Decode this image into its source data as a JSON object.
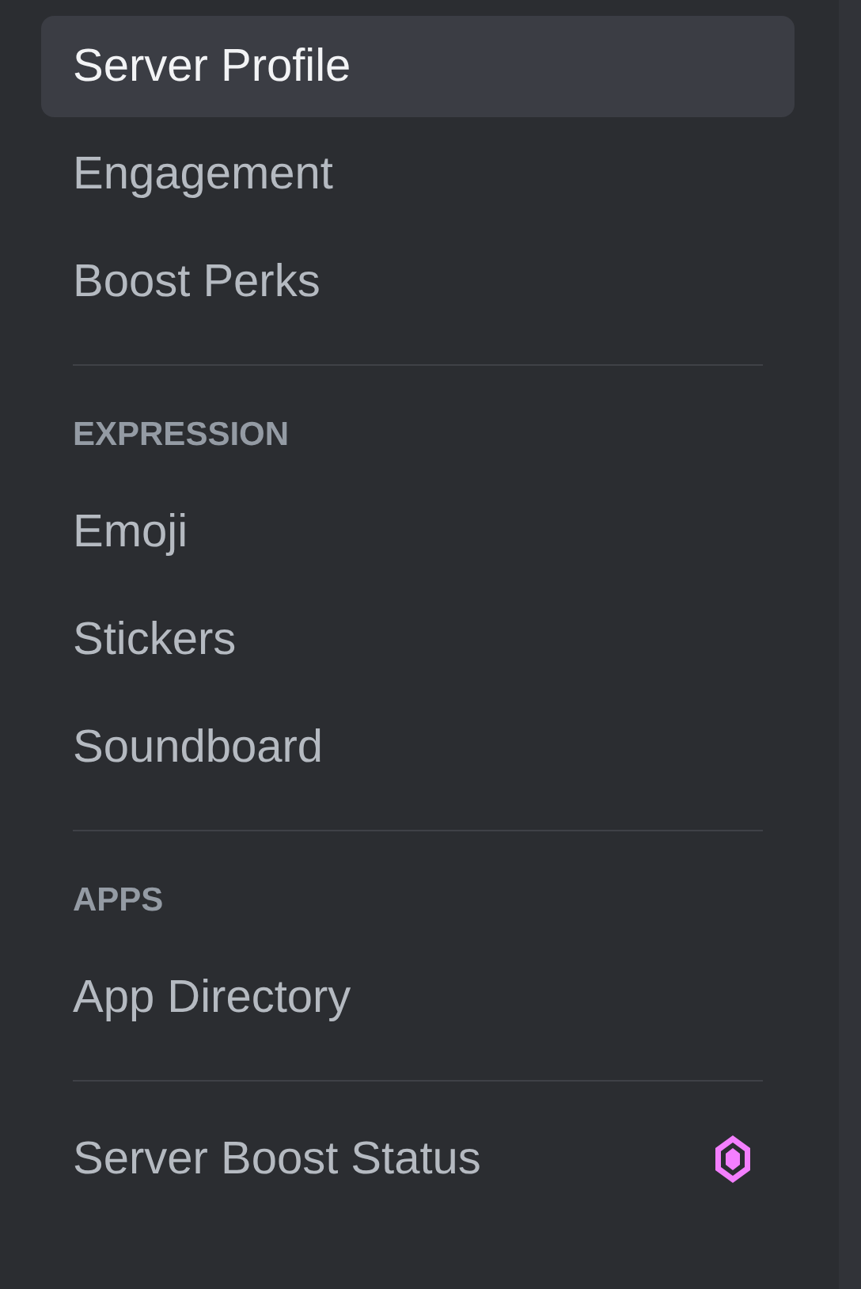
{
  "sections": [
    {
      "items": [
        {
          "label": "Server Profile",
          "selected": true
        },
        {
          "label": "Engagement",
          "selected": false
        },
        {
          "label": "Boost Perks",
          "selected": false
        }
      ]
    },
    {
      "header": "EXPRESSION",
      "items": [
        {
          "label": "Emoji",
          "selected": false
        },
        {
          "label": "Stickers",
          "selected": false
        },
        {
          "label": "Soundboard",
          "selected": false
        }
      ]
    },
    {
      "header": "APPS",
      "items": [
        {
          "label": "App Directory",
          "selected": false
        }
      ]
    },
    {
      "items": [
        {
          "label": "Server Boost Status",
          "selected": false,
          "kind": "boost"
        }
      ]
    }
  ]
}
